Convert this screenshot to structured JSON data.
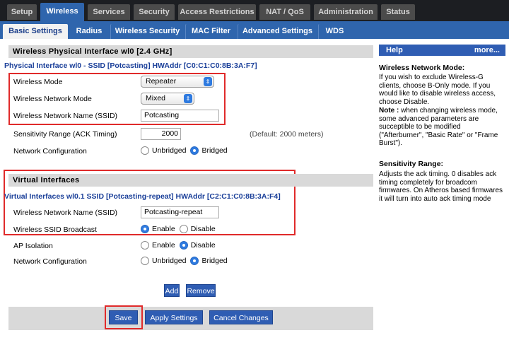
{
  "top_tabs": [
    "Setup",
    "Wireless",
    "Services",
    "Security",
    "Access Restrictions",
    "NAT / QoS",
    "Administration",
    "Status"
  ],
  "sub_tabs": [
    "Basic Settings",
    "Radius",
    "Wireless Security",
    "MAC Filter",
    "Advanced Settings",
    "WDS"
  ],
  "physical": {
    "heading": "Wireless Physical Interface wl0 [2.4 GHz]",
    "iface_line": "Physical Interface wl0 - SSID [Potcasting] HWAddr [C0:C1:C0:8B:3A:F7]",
    "wireless_mode_label": "Wireless Mode",
    "wireless_mode_value": "Repeater",
    "network_mode_label": "Wireless Network Mode",
    "network_mode_value": "Mixed",
    "ssid_label": "Wireless Network Name (SSID)",
    "ssid_value": "Potcasting",
    "sensitivity_label": "Sensitivity Range (ACK Timing)",
    "sensitivity_value": "2000",
    "sensitivity_hint": "(Default: 2000 meters)",
    "netconf_label": "Network Configuration",
    "unbridged": "Unbridged",
    "bridged": "Bridged"
  },
  "virtual": {
    "heading": "Virtual Interfaces",
    "iface_line": "Virtual Interfaces wl0.1 SSID [Potcasting-repeat] HWAddr [C2:C1:C0:8B:3A:F4]",
    "ssid_label": "Wireless Network Name (SSID)",
    "ssid_value": "Potcasting-repeat",
    "broadcast_label": "Wireless SSID Broadcast",
    "enable": "Enable",
    "disable": "Disable",
    "ap_isolation_label": "AP Isolation",
    "netconf_label": "Network Configuration",
    "unbridged": "Unbridged",
    "bridged": "Bridged"
  },
  "buttons": {
    "add": "Add",
    "remove": "Remove",
    "save": "Save",
    "apply": "Apply Settings",
    "cancel": "Cancel Changes"
  },
  "help": {
    "title": "Help",
    "more": "more...",
    "mode_title": "Wireless Network Mode:",
    "mode_text": "If you wish to exclude Wireless-G clients, choose B-Only mode. If you would like to disable wireless access, choose Disable.",
    "note_label": "Note :",
    "note_text": "when changing wireless mode, some advanced parameters are succeptible to be modified (\"Afterburner\", \"Basic Rate\" or \"Frame Burst\").",
    "sens_title": "Sensitivity Range:",
    "sens_text": "Adjusts the ack timing. 0 disables ack timing completely for broadcom firmwares. On Atheros based firmwares it will turn into auto ack timing mode"
  },
  "colors": {
    "nav_active": "#2f65ad",
    "button": "#2f5db3",
    "highlight": "#e02a2a",
    "link_text": "#1a3f99"
  }
}
